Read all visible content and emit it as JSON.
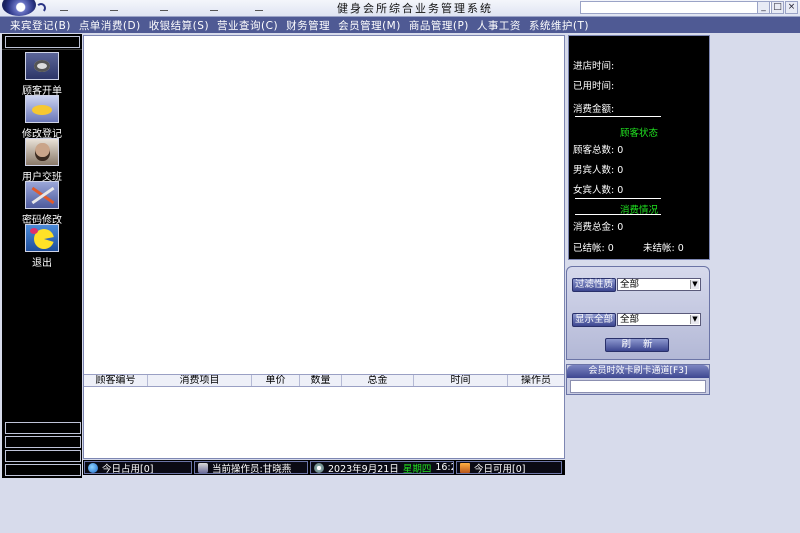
{
  "window": {
    "title": "健身会所综合业务管理系统",
    "controls": [
      "_",
      "□",
      "×"
    ]
  },
  "menu": [
    "来宾登记(B)",
    "点单消费(D)",
    "收银结算(S)",
    "营业查询(C)",
    "财务管理",
    "会员管理(M)",
    "商品管理(P)",
    "人事工资",
    "系统维护(T)"
  ],
  "sidebar": {
    "buttons": [
      {
        "label": "顾客开单",
        "icon": "open-order-icon"
      },
      {
        "label": "修改登记",
        "icon": "modify-registration-icon"
      },
      {
        "label": "用户交班",
        "icon": "user-handover-icon"
      },
      {
        "label": "密码修改",
        "icon": "password-change-icon"
      },
      {
        "label": "退出",
        "icon": "exit-icon"
      }
    ]
  },
  "table": {
    "columns": [
      "顾客编号",
      "消费项目",
      "单价",
      "数量",
      "总金",
      "时间",
      "操作员"
    ]
  },
  "info_panel": {
    "enter_time": "进店时间:",
    "used_time": "已用时间:",
    "consume_amount": "消费金额:",
    "customer_status_header": "顾客状态",
    "total_customers": "顾客总数: 0",
    "male_count": "男宾人数: 0",
    "female_count": "女宾人数: 0",
    "consumption_header": "消费情况",
    "consumption_total": "消费总金: 0",
    "settled": "已结帐: 0",
    "unsettled": "未结帐: 0"
  },
  "filter": {
    "filter_gender_label": "过滤性质",
    "filter_gender_value": "全部",
    "show_all_label": "显示全部",
    "show_all_value": "全部",
    "refresh_label": "刷    新"
  },
  "member_channel": {
    "label": "会员时效卡刷卡通道[F3]",
    "value": ""
  },
  "status": {
    "today_occupied": "今日占用[0]",
    "current_operator": "当前操作员:甘晓燕",
    "date": "2023年9月21日",
    "weekday": "星期四",
    "time": "16:29",
    "today_available": "今日可用[0]"
  }
}
